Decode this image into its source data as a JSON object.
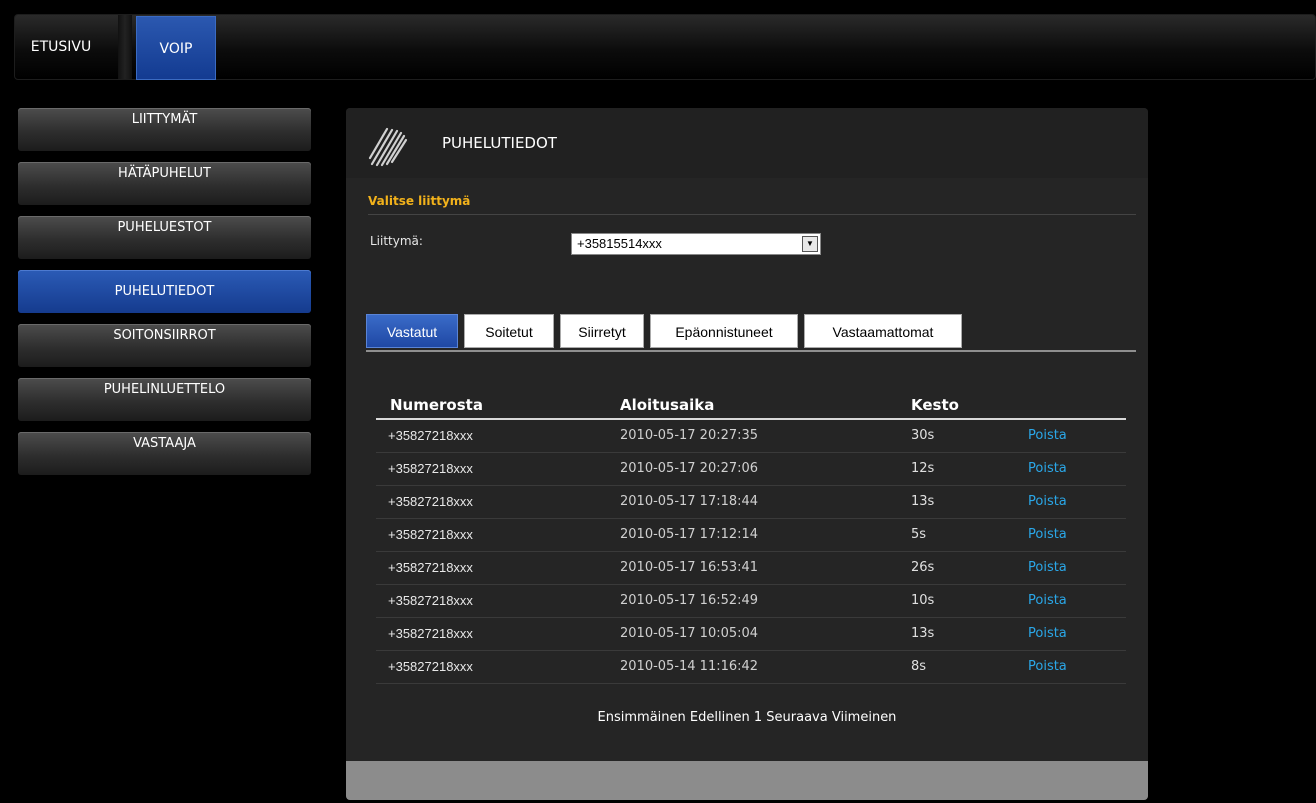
{
  "top_nav": {
    "tabs": [
      {
        "label": "ETUSIVU"
      },
      {
        "label": "VOIP"
      }
    ]
  },
  "sidebar": {
    "items": [
      {
        "label": "LIITTYMÄT"
      },
      {
        "label": "HÄTÄPUHELUT"
      },
      {
        "label": "PUHELUESTOT"
      },
      {
        "label": "PUHELUTIEDOT"
      },
      {
        "label": "SOITONSIIRROT"
      },
      {
        "label": "PUHELINLUETTELO"
      },
      {
        "label": "VASTAAJA"
      }
    ],
    "active_index": 3
  },
  "panel": {
    "title": "PUHELUTIEDOT",
    "section_label": "Valitse liittymä",
    "field_label": "Liittymä:",
    "selected_subscription": "+35815514xxx"
  },
  "tabs": [
    {
      "label": "Vastatut"
    },
    {
      "label": "Soitetut"
    },
    {
      "label": "Siirretyt"
    },
    {
      "label": "Epäonnistuneet"
    },
    {
      "label": "Vastaamattomat"
    }
  ],
  "table": {
    "headers": {
      "number": "Numerosta",
      "start": "Aloitusaika",
      "duration": "Kesto"
    },
    "rows": [
      {
        "number": "+35827218xxx",
        "start": "2010-05-17 20:27:35",
        "duration": "30s",
        "action": "Poista"
      },
      {
        "number": "+35827218xxx",
        "start": "2010-05-17 20:27:06",
        "duration": "12s",
        "action": "Poista"
      },
      {
        "number": "+35827218xxx",
        "start": "2010-05-17 17:18:44",
        "duration": "13s",
        "action": "Poista"
      },
      {
        "number": "+35827218xxx",
        "start": "2010-05-17 17:12:14",
        "duration": "5s",
        "action": "Poista"
      },
      {
        "number": "+35827218xxx",
        "start": "2010-05-17 16:53:41",
        "duration": "26s",
        "action": "Poista"
      },
      {
        "number": "+35827218xxx",
        "start": "2010-05-17 16:52:49",
        "duration": "10s",
        "action": "Poista"
      },
      {
        "number": "+35827218xxx",
        "start": "2010-05-17 10:05:04",
        "duration": "13s",
        "action": "Poista"
      },
      {
        "number": "+35827218xxx",
        "start": "2010-05-14 11:16:42",
        "duration": "8s",
        "action": "Poista"
      }
    ]
  },
  "pager": {
    "first": "Ensimmäinen",
    "prev": "Edellinen",
    "page": "1",
    "next": "Seuraava",
    "last": "Viimeinen"
  },
  "colors": {
    "accent_blue": "#1f48a4",
    "section_label": "#f2b21b",
    "link": "#2aa7e8"
  }
}
